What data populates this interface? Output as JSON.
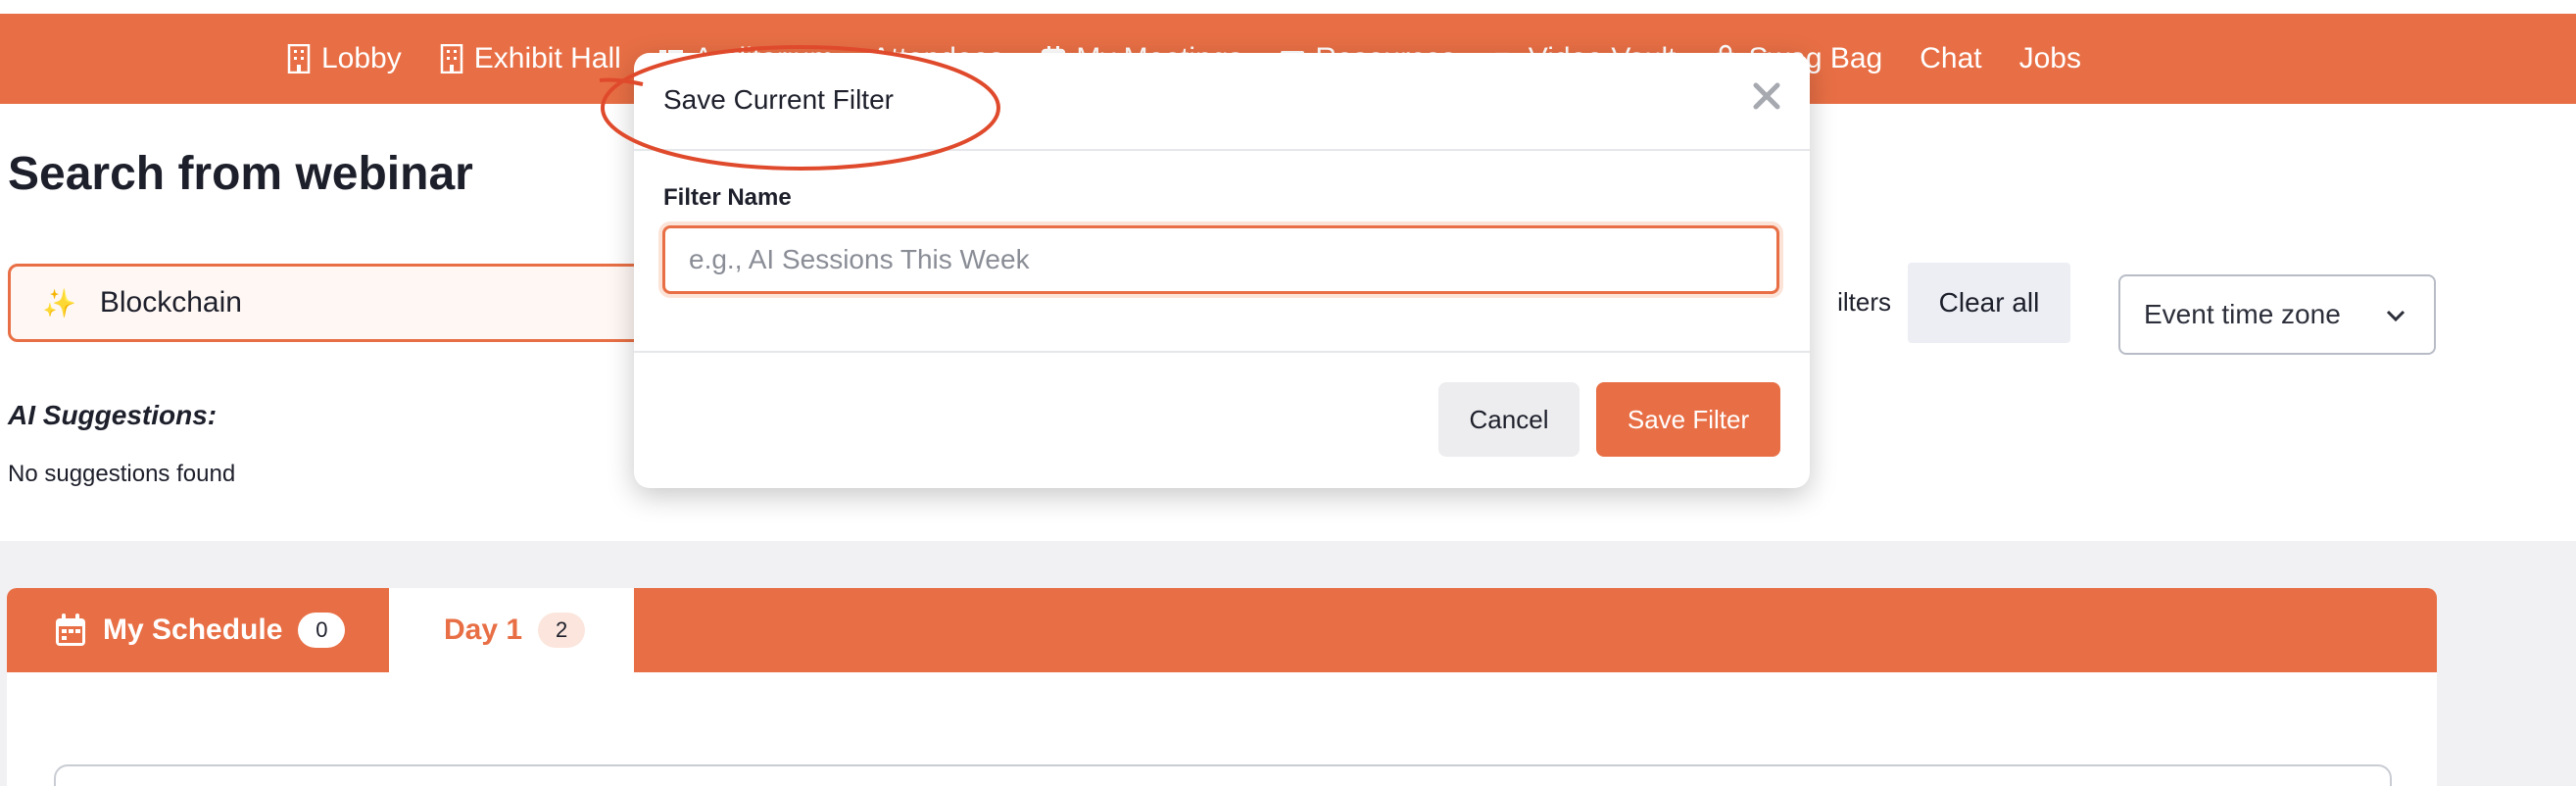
{
  "nav": {
    "items": [
      {
        "label": "Lobby",
        "icon": "building-icon"
      },
      {
        "label": "Exhibit Hall",
        "icon": "building-icon"
      },
      {
        "label": "Auditorium",
        "icon": "list-icon"
      },
      {
        "label": "Attendees",
        "icon": ""
      },
      {
        "label": "My Meetings",
        "icon": "calendar-icon"
      },
      {
        "label": "Resources",
        "icon": "folder-icon"
      },
      {
        "label": "Video Vault",
        "icon": "video-icon"
      },
      {
        "label": "Swag Bag",
        "icon": "bag-icon"
      },
      {
        "label": "Chat",
        "icon": ""
      },
      {
        "label": "Jobs",
        "icon": ""
      }
    ]
  },
  "search": {
    "title": "Search from webinar",
    "query": "Blockchain",
    "spark_glyph": "✨",
    "filters_label": "ilters",
    "clear_label": "Clear all",
    "timezone_label": "Event time zone",
    "ai_suggestions_label": "AI Suggestions:",
    "no_suggestions": "No suggestions found"
  },
  "tabs": {
    "schedule": {
      "label": "My Schedule",
      "count": "0"
    },
    "day": {
      "label": "Day 1",
      "count": "2"
    }
  },
  "modal": {
    "title": "Save Current Filter",
    "field_label": "Filter Name",
    "placeholder": "e.g., AI Sessions This Week",
    "cancel_label": "Cancel",
    "save_label": "Save Filter"
  },
  "colors": {
    "accent": "#e86f45",
    "annotation": "#e04a2c"
  }
}
